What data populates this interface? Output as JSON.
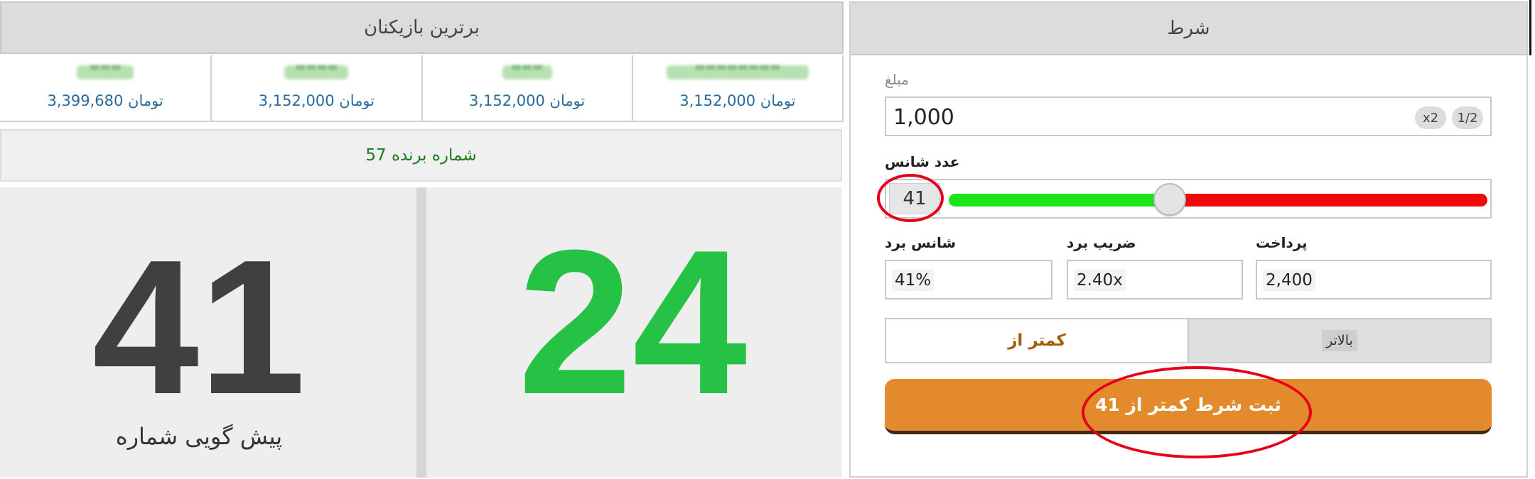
{
  "top_players": {
    "title": "برترین بازیکنان",
    "players": [
      {
        "name": "▬▬▬▬▬▬▬▬",
        "amount": "تومان 3,152,000"
      },
      {
        "name": "▬▬▬",
        "amount": "تومان 3,152,000"
      },
      {
        "name": "▬▬▬▬",
        "amount": "تومان 3,152,000"
      },
      {
        "name": "▬▬▬",
        "amount": "تومان 3,399,680"
      }
    ]
  },
  "game": {
    "winner_text": "شماره برنده 57",
    "result_number": "24",
    "prediction_number": "41",
    "prediction_label": "پیش گویی شماره",
    "colors": {
      "result": "#26c245",
      "prediction": "#404040"
    }
  },
  "bet": {
    "title": "شرط",
    "amount_label": "مبلغ",
    "amount_value": "1,000",
    "double_label": "x2",
    "half_label": "1/2",
    "chance_label": "عدد شانس",
    "chance_value": "41",
    "slider_fraction": 0.41,
    "win_chance_label": "شانس برد",
    "win_chance_value": "41%",
    "multiplier_label": "ضریب برد",
    "multiplier_value": "2.40x",
    "payout_label": "پرداخت",
    "payout_value": "2,400",
    "less_than_label": "کمتر از",
    "more_than_label": "بالاتر",
    "submit_label": "ثبت شرط کمتر از 41",
    "colors": {
      "submit": "#e38b2c",
      "track_low": "#19e619",
      "track_high": "#ee0a0a",
      "annotation": "#e5001a"
    }
  }
}
